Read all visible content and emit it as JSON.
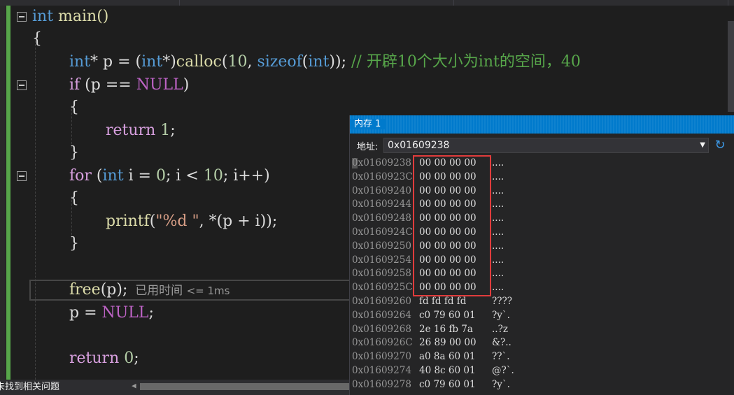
{
  "code": {
    "l0": {
      "kw": "int",
      "rest": " main()"
    },
    "l1": "{",
    "l2": {
      "t1": "int",
      "t2": "* p = (",
      "t3": "int",
      "t4": "*)",
      "fn": "calloc",
      "t5": "(",
      "n": "10",
      "t6": ", ",
      "kw2": "sizeof",
      "t7": "(",
      "t8": "int",
      "t9": ")); ",
      "cmt": "// 开辟10个大小为int的空间，40"
    },
    "l3": {
      "kw": "if",
      "t1": " (p == ",
      "mac": "NULL",
      "t2": ")"
    },
    "l4": "{",
    "l5": {
      "kw": "return",
      "sp": " ",
      "n": "1",
      "t": ";"
    },
    "l6": "}",
    "l7": {
      "kw": "for",
      "t1": " (",
      "kw2": "int",
      "t2": " i = ",
      "n0": "0",
      "t3": "; i < ",
      "n1": "10",
      "t4": "; i++)"
    },
    "l8": "{",
    "l9": {
      "fn": "printf",
      "t1": "(",
      "str": "\"%d \"",
      "t2": ", *(p + i));"
    },
    "l10": "}",
    "l11": {
      "fn": "free",
      "t1": "(p);",
      "hint": "已用时间",
      "hint2": "<= 1ms"
    },
    "l12": {
      "t1": "p = ",
      "mac": "NULL",
      "t2": ";"
    },
    "l13": {
      "kw": "return",
      "sp": " ",
      "n": "0",
      "t": ";"
    }
  },
  "status": {
    "text": "未找到相关问题"
  },
  "memory": {
    "title": "内存 1",
    "address_label": "地址:",
    "address_value": "0x01609238",
    "rows": [
      {
        "addr": "0x01609238",
        "hex": "00 00 00 00",
        "chars": "...."
      },
      {
        "addr": "0x0160923C",
        "hex": "00 00 00 00",
        "chars": "...."
      },
      {
        "addr": "0x01609240",
        "hex": "00 00 00 00",
        "chars": "...."
      },
      {
        "addr": "0x01609244",
        "hex": "00 00 00 00",
        "chars": "...."
      },
      {
        "addr": "0x01609248",
        "hex": "00 00 00 00",
        "chars": "...."
      },
      {
        "addr": "0x0160924C",
        "hex": "00 00 00 00",
        "chars": "...."
      },
      {
        "addr": "0x01609250",
        "hex": "00 00 00 00",
        "chars": "...."
      },
      {
        "addr": "0x01609254",
        "hex": "00 00 00 00",
        "chars": "...."
      },
      {
        "addr": "0x01609258",
        "hex": "00 00 00 00",
        "chars": "...."
      },
      {
        "addr": "0x0160925C",
        "hex": "00 00 00 00",
        "chars": "...."
      },
      {
        "addr": "0x01609260",
        "hex": "fd fd fd fd",
        "chars": "????"
      },
      {
        "addr": "0x01609264",
        "hex": "c0 79 60 01",
        "chars": "?y`."
      },
      {
        "addr": "0x01609268",
        "hex": "2e 16 fb 7a",
        "chars": "..?z"
      },
      {
        "addr": "0x0160926C",
        "hex": "26 89 00 00",
        "chars": "&?.."
      },
      {
        "addr": "0x01609270",
        "hex": "a0 8a 60 01",
        "chars": "??`."
      },
      {
        "addr": "0x01609274",
        "hex": "40 8c 60 01",
        "chars": "@?`."
      },
      {
        "addr": "0x01609278",
        "hex": "c0 79 60 01",
        "chars": "?y`."
      }
    ]
  },
  "colors": {
    "title_bar": "#007acc",
    "highlight_box": "#e03c3c",
    "change_bar": "#57a64a"
  }
}
